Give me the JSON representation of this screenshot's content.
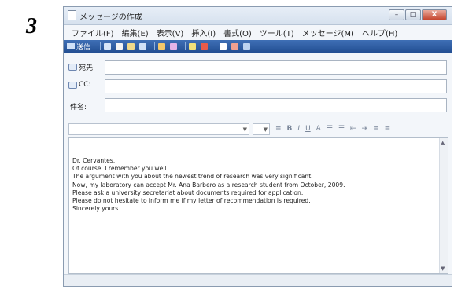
{
  "step_number": "3",
  "window": {
    "title": "メッセージの作成",
    "buttons": {
      "minimize": "–",
      "maximize": "□",
      "close": "X"
    }
  },
  "menu": [
    "ファイル(F)",
    "編集(E)",
    "表示(V)",
    "挿入(I)",
    "書式(O)",
    "ツール(T)",
    "メッセージ(M)",
    "ヘルプ(H)"
  ],
  "toolbar": {
    "send_label": "送信"
  },
  "header": {
    "to_label": "宛先:",
    "cc_label": "CC:",
    "subject_label": "件名:",
    "to_value": "",
    "cc_value": "",
    "subject_value": ""
  },
  "format_bar": {
    "bold": "B",
    "italic": "I",
    "underline": "U",
    "font_color": "A"
  },
  "message": {
    "lines": [
      "Dr. Cervantes,",
      "Of course, I remember you well.",
      "The argument with you about the newest trend of research was very significant.",
      "Now, my laboratory can accept Mr. Ana Barbero as a research student from October, 2009.",
      "Please ask a university secretariat about documents required for application.",
      "Please do not hesitate to inform me if my letter of recommendation is required.",
      "Sincerely yours"
    ]
  },
  "colors": {
    "toolbar": "#2f5fa5",
    "close_button": "#c5462f"
  }
}
